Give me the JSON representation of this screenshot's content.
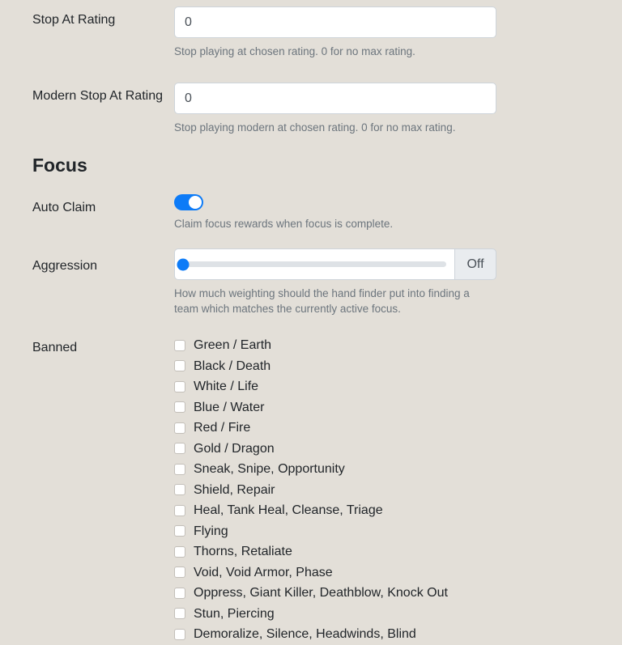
{
  "settings": {
    "stop_at_rating": {
      "label": "Stop At Rating",
      "value": "0",
      "placeholder": "0",
      "help": "Stop playing at chosen rating. 0 for no max rating."
    },
    "modern_stop_at_rating": {
      "label": "Modern Stop At Rating",
      "value": "0",
      "placeholder": "0",
      "help": "Stop playing modern at chosen rating. 0 for no max rating."
    }
  },
  "focus": {
    "heading": "Focus",
    "auto_claim": {
      "label": "Auto Claim",
      "state": "on",
      "help": "Claim focus rewards when focus is complete."
    },
    "aggression": {
      "label": "Aggression",
      "value": 0,
      "min": 0,
      "max": 100,
      "addon_label": "Off",
      "help": "How much weighting should the hand finder put into finding a team which matches the currently active focus."
    },
    "banned": {
      "label": "Banned",
      "items": [
        {
          "label": "Green / Earth",
          "checked": false
        },
        {
          "label": "Black / Death",
          "checked": false
        },
        {
          "label": "White / Life",
          "checked": false
        },
        {
          "label": "Blue / Water",
          "checked": false
        },
        {
          "label": "Red / Fire",
          "checked": false
        },
        {
          "label": "Gold / Dragon",
          "checked": false
        },
        {
          "label": "Sneak, Snipe, Opportunity",
          "checked": false
        },
        {
          "label": "Shield, Repair",
          "checked": false
        },
        {
          "label": "Heal, Tank Heal, Cleanse, Triage",
          "checked": false
        },
        {
          "label": "Flying",
          "checked": false
        },
        {
          "label": "Thorns, Retaliate",
          "checked": false
        },
        {
          "label": "Void, Void Armor, Phase",
          "checked": false
        },
        {
          "label": "Oppress, Giant Killer, Deathblow, Knock Out",
          "checked": false
        },
        {
          "label": "Stun, Piercing",
          "checked": false
        },
        {
          "label": "Demoralize, Silence, Headwinds, Blind",
          "checked": false
        }
      ]
    }
  },
  "colors": {
    "background": "#e3dfd8",
    "accent": "#0d7bf7",
    "help_text": "#6c757d",
    "input_border": "#ced4da"
  }
}
